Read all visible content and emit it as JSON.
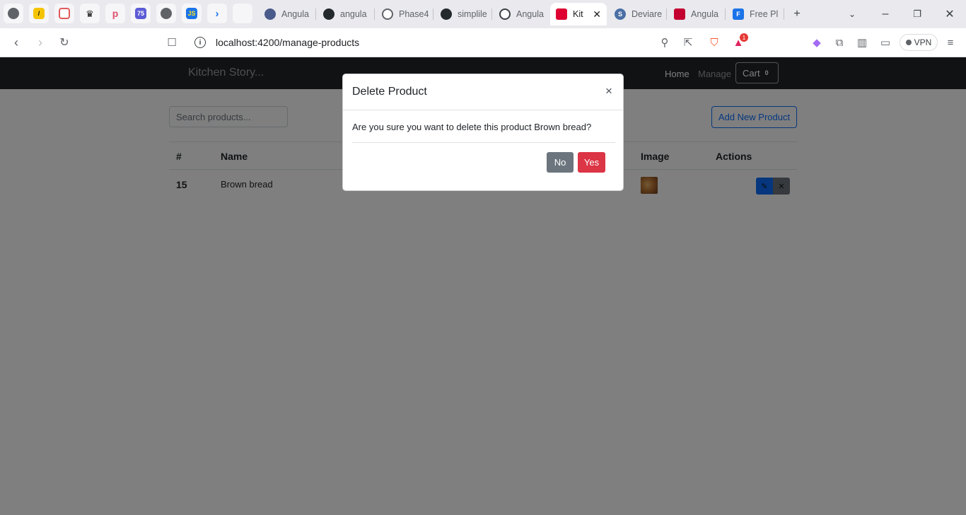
{
  "browser": {
    "tabs": [
      {
        "title": "Angula"
      },
      {
        "title": "angula"
      },
      {
        "title": "Phase4"
      },
      {
        "title": "simplile"
      },
      {
        "title": "Angula"
      },
      {
        "title": "Kit",
        "close": "✕"
      },
      {
        "title": "Deviare"
      },
      {
        "title": "Angula"
      },
      {
        "title": "Free Pl"
      }
    ],
    "pinned_labels": {
      "p75": "75",
      "js": "JS"
    },
    "new_tab": "+",
    "url": "localhost:4200/manage-products",
    "vpn_label": "VPN",
    "badge_count": "1"
  },
  "navbar": {
    "brand": "Kitchen Story...",
    "home": "Home",
    "manage": "Manage",
    "cart_label": "Cart",
    "cart_count": "0"
  },
  "toolbar": {
    "search_placeholder": "Search products...",
    "add_button": "Add New Product"
  },
  "table": {
    "headers": [
      "#",
      "Name",
      "Image",
      "Actions"
    ],
    "rows": [
      {
        "id": "15",
        "name": "Brown bread"
      }
    ]
  },
  "modal": {
    "title": "Delete Product",
    "close": "×",
    "message": "Are you sure you want to delete this product Brown bread?",
    "no": "No",
    "yes": "Yes"
  },
  "colors": {
    "navbar": "#212529",
    "primary": "#0d6efd",
    "danger": "#dc3545",
    "secondary": "#6c757d"
  }
}
